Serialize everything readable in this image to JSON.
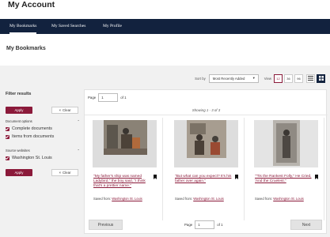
{
  "header": {
    "title": "My Account"
  },
  "nav": {
    "items": [
      {
        "label": "My Bookmarks"
      },
      {
        "label": "My Saved Searches"
      },
      {
        "label": "My Profile"
      }
    ]
  },
  "page": {
    "section_title": "My Bookmarks"
  },
  "toolbar": {
    "sort_label": "Sort by",
    "sort_value": "Most Recently Added",
    "view_label": "View",
    "per_page": [
      "12",
      "36",
      "96"
    ]
  },
  "filters": {
    "title": "Filter results",
    "apply": "Apply",
    "clear": "Clear",
    "groups": [
      {
        "label": "Document options",
        "options": [
          "Complete documents",
          "Items from documents"
        ]
      },
      {
        "label": "Source websites",
        "options": [
          "Washington St. Louis"
        ]
      }
    ]
  },
  "results": {
    "page_label": "Page",
    "page_value": "1",
    "of_label": "of 1",
    "showing": "Showing 1 - 3 of 3",
    "saved_from_label": "Saved from:",
    "items": [
      {
        "title": "\"My father's ship was named Ladybird,\" the boy said, \"I think that's a prettier name.\"",
        "source": "Washington St. Louis"
      },
      {
        "title": "\"But what can you expect? It's his father over again.\"",
        "source": "Washington St. Louis"
      },
      {
        "title": "\"'Tis the Rankest Folly,\" He Cried, 'And the Cruelest.\"",
        "source": "Washington St. Louis"
      }
    ],
    "prev": "Previous",
    "next": "Next"
  },
  "colors": {
    "nav_bg": "#12223e",
    "accent": "#8b1a3a"
  }
}
